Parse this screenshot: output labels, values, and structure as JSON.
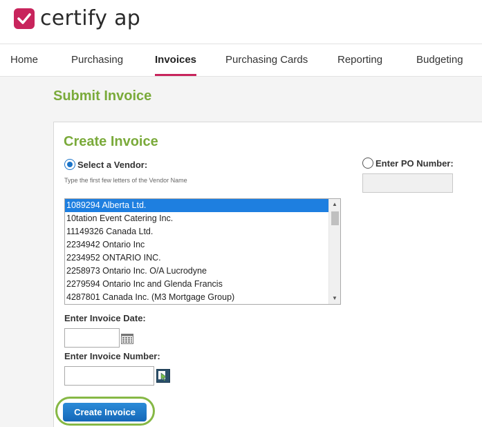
{
  "logo": {
    "text": "certify ap",
    "brand_color": "#c8245c"
  },
  "nav": {
    "items": [
      {
        "label": "Home"
      },
      {
        "label": "Purchasing"
      },
      {
        "label": "Invoices",
        "active": true
      },
      {
        "label": "Purchasing Cards"
      },
      {
        "label": "Reporting"
      },
      {
        "label": "Budgeting"
      }
    ],
    "active_color": "#c8245c"
  },
  "page": {
    "title": "Submit Invoice",
    "accent_color": "#7aaa3a"
  },
  "form": {
    "title": "Create Invoice",
    "vendor_radio_label": "Select a Vendor:",
    "vendor_radio_checked": true,
    "po_radio_label": "Enter PO Number:",
    "po_radio_checked": false,
    "vendor_hint": "Type the first few letters of the Vendor Name",
    "po_value": "",
    "vendors": [
      "1089294 Alberta Ltd.",
      "10tation Event Catering Inc.",
      "11149326 Canada Ltd.",
      "2234942 Ontario Inc",
      "2234952 ONTARIO INC.",
      "2258973 Ontario Inc. O/A Lucrodyne",
      "2279594 Ontario Inc and Glenda Francis",
      "4287801 Canada Inc. (M3 Mortgage Group)"
    ],
    "selected_vendor_index": 0,
    "invoice_date_label": "Enter Invoice Date:",
    "invoice_date_value": "",
    "invoice_number_label": "Enter Invoice Number:",
    "invoice_number_value": "",
    "submit_label": "Create Invoice",
    "icons": {
      "date": "calendar-icon",
      "lookup": "lookup-icon"
    }
  }
}
